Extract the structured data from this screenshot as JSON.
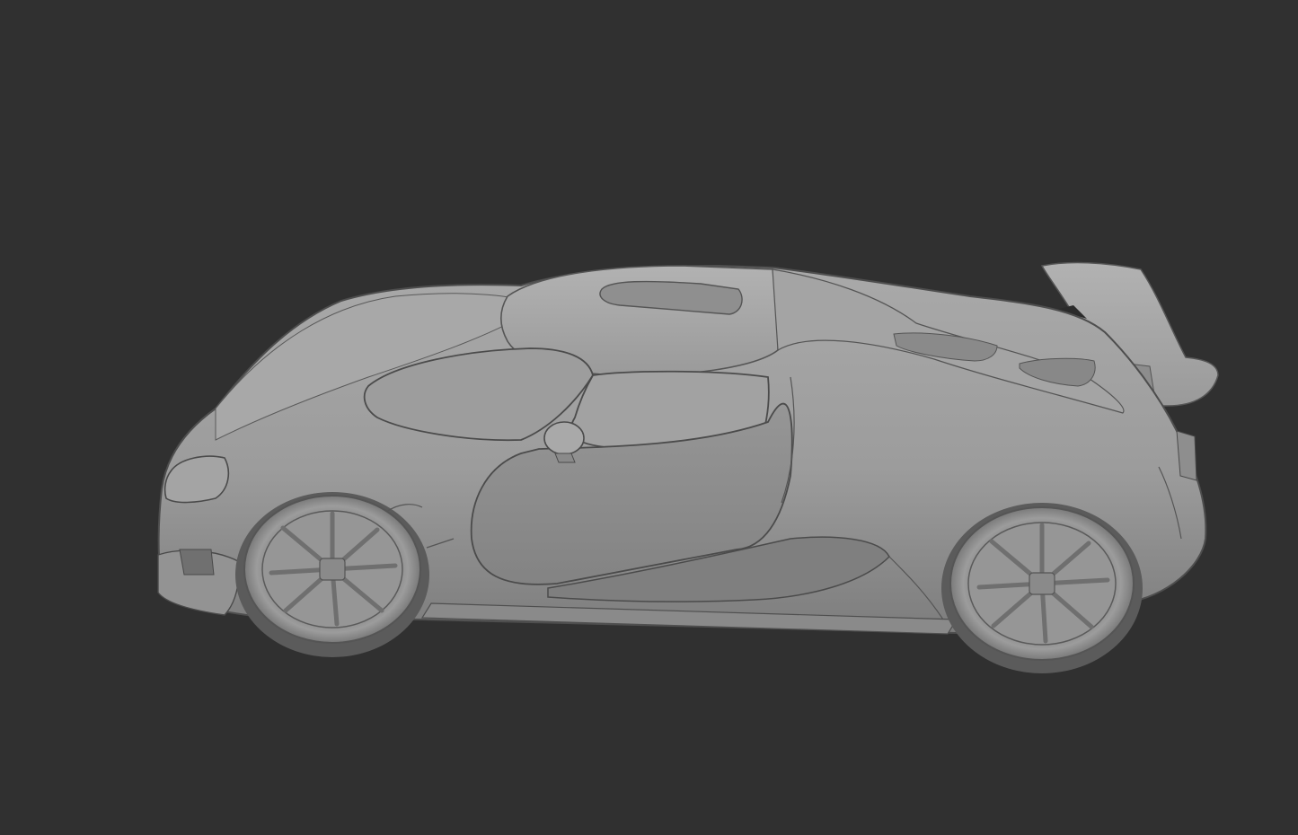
{
  "viewport": {
    "background": "#303030",
    "shading": "solid",
    "model": {
      "object": "car",
      "body_color": "#9a9a9a",
      "highlight_color": "#b3b3b3",
      "shadow_color": "#6e6e6e",
      "edge_color": "#4a4a4a"
    }
  }
}
